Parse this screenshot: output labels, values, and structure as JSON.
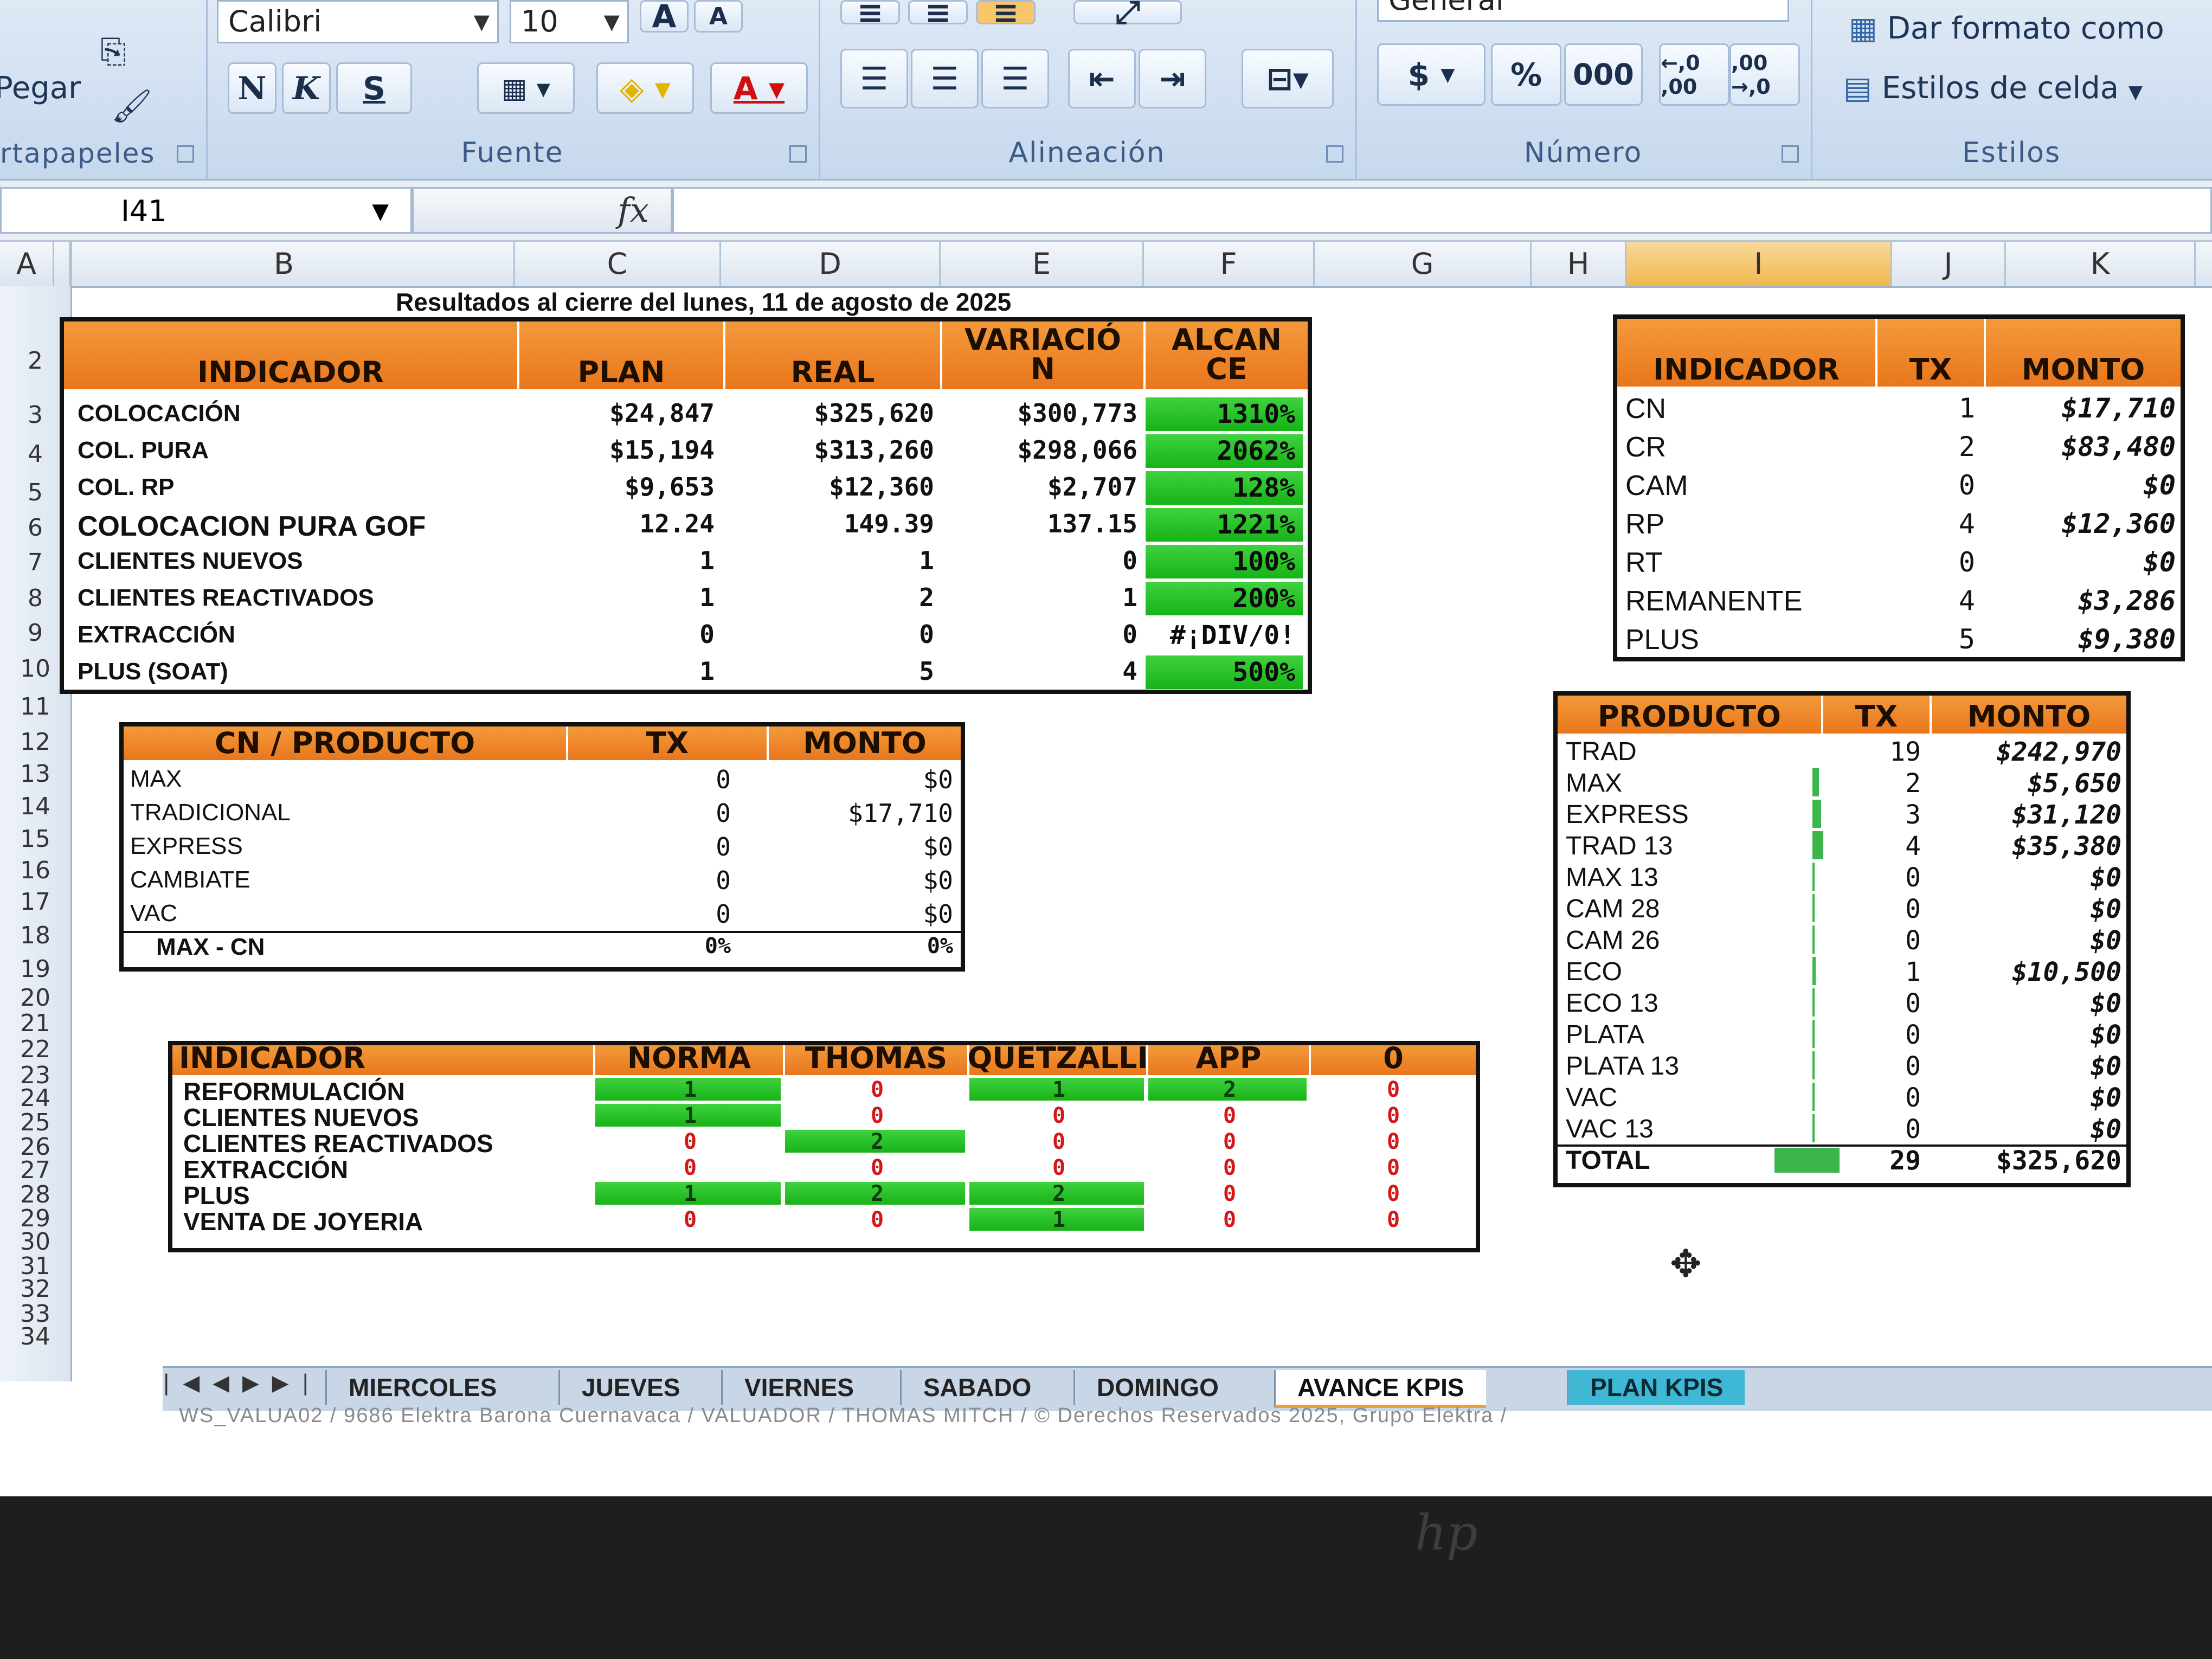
{
  "ribbon": {
    "pegar": "Pegar",
    "portapapeles": "rtapapeles",
    "font_name": "Calibri",
    "font_size": "10",
    "grow": "A",
    "shrink": "A",
    "bold": "N",
    "italic": "K",
    "underline": "S",
    "fuente": "Fuente",
    "alineacion": "Alineación",
    "numero": "Número",
    "number_format": "General",
    "currency": "$",
    "percent": "%",
    "thousands": "000",
    "inc_dec": "←,0 ,00",
    "dec_dec": ",00 →,0",
    "dar_formato": "Dar formato como",
    "estilos_celda": "Estilos de celda",
    "estilos": "Estilos"
  },
  "formula_bar": {
    "name_box": "I41",
    "fx": "fx",
    "formula": ""
  },
  "columns": [
    "A",
    "B",
    "C",
    "D",
    "E",
    "F",
    "G",
    "H",
    "I",
    "J",
    "K"
  ],
  "rows": [
    "2",
    "3",
    "4",
    "5",
    "6",
    "7",
    "8",
    "9",
    "10",
    "11",
    "12",
    "13",
    "14",
    "15",
    "16",
    "17",
    "18",
    "19",
    "20",
    "21",
    "22",
    "23",
    "24",
    "25",
    "26",
    "27",
    "28",
    "29",
    "30",
    "31",
    "32",
    "33",
    "34"
  ],
  "title": "Resultados al cierre del  lunes, 11 de agosto de 2025",
  "kpi": {
    "headers": [
      "INDICADOR",
      "PLAN",
      "REAL",
      "VARIACIÓN",
      "ALCANCE"
    ],
    "header_lines": {
      "variacion_1": "VARIACIÓ",
      "variacion_2": "N",
      "alcance_1": "ALCAN",
      "alcance_2": "CE"
    },
    "rows": [
      {
        "label": "COLOCACIÓN",
        "plan": "$24,847",
        "real": "$325,620",
        "var": "$300,773",
        "alc": "1310%"
      },
      {
        "label": "COL. PURA",
        "plan": "$15,194",
        "real": "$313,260",
        "var": "$298,066",
        "alc": "2062%"
      },
      {
        "label": "COL. RP",
        "plan": "$9,653",
        "real": "$12,360",
        "var": "$2,707",
        "alc": "128%"
      },
      {
        "label": "COLOCACION PURA GOF",
        "plan": "12.24",
        "real": "149.39",
        "var": "137.15",
        "alc": "1221%"
      },
      {
        "label": "CLIENTES NUEVOS",
        "plan": "1",
        "real": "1",
        "var": "0",
        "alc": "100%"
      },
      {
        "label": "CLIENTES REACTIVADOS",
        "plan": "1",
        "real": "2",
        "var": "1",
        "alc": "200%"
      },
      {
        "label": "EXTRACCIÓN",
        "plan": "0",
        "real": "0",
        "var": "0",
        "alc": "#¡DIV/0!"
      },
      {
        "label": "PLUS (SOAT)",
        "plan": "1",
        "real": "5",
        "var": "4",
        "alc": "500%"
      }
    ]
  },
  "cn": {
    "headers": [
      "CN / PRODUCTO",
      "TX",
      "MONTO"
    ],
    "rows": [
      {
        "label": "MAX",
        "tx": "0",
        "monto": "$0"
      },
      {
        "label": "TRADICIONAL",
        "tx": "0",
        "monto": "$17,710"
      },
      {
        "label": "EXPRESS",
        "tx": "0",
        "monto": "$0"
      },
      {
        "label": "CAMBIATE",
        "tx": "0",
        "monto": "$0"
      },
      {
        "label": "VAC",
        "tx": "0",
        "monto": "$0"
      }
    ],
    "total": {
      "label": "MAX - CN",
      "tx": "0%",
      "monto": "0%"
    }
  },
  "people": {
    "headers": [
      "INDICADOR",
      "NORMA",
      "THOMAS",
      "QUETZALLI",
      "APP",
      "0"
    ],
    "rows": [
      {
        "label": "REFORMULACIÓN",
        "values": [
          "1",
          "0",
          "1",
          "2",
          "0"
        ]
      },
      {
        "label": "CLIENTES NUEVOS",
        "values": [
          "1",
          "0",
          "0",
          "0",
          "0"
        ]
      },
      {
        "label": "CLIENTES REACTIVADOS",
        "values": [
          "0",
          "2",
          "0",
          "0",
          "0"
        ]
      },
      {
        "label": "EXTRACCIÓN",
        "values": [
          "0",
          "0",
          "0",
          "0",
          "0"
        ]
      },
      {
        "label": "PLUS",
        "values": [
          "1",
          "2",
          "2",
          "0",
          "0"
        ]
      },
      {
        "label": "VENTA DE JOYERIA",
        "values": [
          "0",
          "0",
          "1",
          "0",
          "0"
        ]
      }
    ]
  },
  "ind": {
    "headers": [
      "INDICADOR",
      "TX",
      "MONTO"
    ],
    "rows": [
      {
        "label": "CN",
        "tx": "1",
        "monto": "$17,710"
      },
      {
        "label": "CR",
        "tx": "2",
        "monto": "$83,480"
      },
      {
        "label": "CAM",
        "tx": "0",
        "monto": "$0"
      },
      {
        "label": "RP",
        "tx": "4",
        "monto": "$12,360"
      },
      {
        "label": "RT",
        "tx": "0",
        "monto": "$0"
      },
      {
        "label": "REMANENTE",
        "tx": "4",
        "monto": "$3,286"
      },
      {
        "label": "PLUS",
        "tx": "5",
        "monto": "$9,380"
      }
    ]
  },
  "prod": {
    "headers": [
      "PRODUCTO",
      "TX",
      "MONTO"
    ],
    "rows": [
      {
        "label": "TRAD",
        "tx": "19",
        "monto": "$242,970",
        "bar": 0.0
      },
      {
        "label": "MAX",
        "tx": "2",
        "monto": "$5,650",
        "bar": 0.3
      },
      {
        "label": "EXPRESS",
        "tx": "3",
        "monto": "$31,120",
        "bar": 0.4
      },
      {
        "label": "TRAD 13",
        "tx": "4",
        "monto": "$35,380",
        "bar": 0.5
      },
      {
        "label": "MAX 13",
        "tx": "0",
        "monto": "$0",
        "bar": 0.1
      },
      {
        "label": "CAM 28",
        "tx": "0",
        "monto": "$0",
        "bar": 0.1
      },
      {
        "label": "CAM 26",
        "tx": "0",
        "monto": "$0",
        "bar": 0.1
      },
      {
        "label": "ECO",
        "tx": "1",
        "monto": "$10,500",
        "bar": 0.15
      },
      {
        "label": "ECO 13",
        "tx": "0",
        "monto": "$0",
        "bar": 0.1
      },
      {
        "label": "PLATA",
        "tx": "0",
        "monto": "$0",
        "bar": 0.1
      },
      {
        "label": "PLATA 13",
        "tx": "0",
        "monto": "$0",
        "bar": 0.1
      },
      {
        "label": "VAC",
        "tx": "0",
        "monto": "$0",
        "bar": 0.1
      },
      {
        "label": "VAC 13",
        "tx": "0",
        "monto": "$0",
        "bar": 0.1
      }
    ],
    "total": {
      "label": "TOTAL",
      "tx": "29",
      "monto": "$325,620"
    }
  },
  "tabs": [
    "MIERCOLES",
    "JUEVES",
    "VIERNES",
    "SABADO",
    "DOMINGO",
    "AVANCE KPIS",
    "PLAN KPIS"
  ],
  "active_tab": "AVANCE KPIS",
  "footer": "WS_VALUA02  /  9686 Elektra Barona Cuernavaca  /  VALUADOR  /  THOMAS MITCH  /  © Derechos Reservados 2025, Grupo Elektra  /",
  "brand": "hp",
  "colors": {
    "accent_orange": "#e9761c",
    "alc_green": "#17b317",
    "neg_red": "#d21818"
  }
}
